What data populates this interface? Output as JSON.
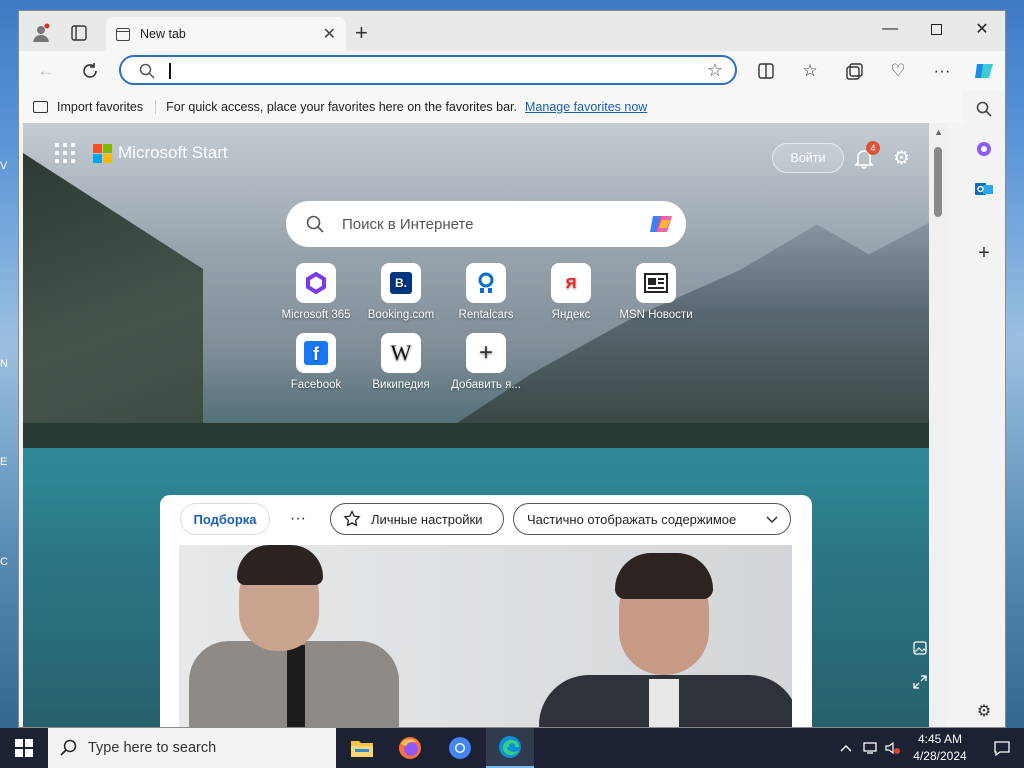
{
  "browser": {
    "tab_title": "New tab",
    "address_value": "",
    "favorites_bar": {
      "import_label": "Import favorites",
      "tip": "For quick access, place your favorites here on the favorites bar.",
      "manage_link": "Manage favorites now"
    }
  },
  "start_page": {
    "brand": "Microsoft Start",
    "sign_in": "Войти",
    "notifications_count": "4",
    "search_placeholder": "Поиск в Интернете",
    "tiles": [
      {
        "label": "Microsoft 365",
        "icon": "microsoft-365-icon"
      },
      {
        "label": "Booking.com",
        "icon": "booking-icon",
        "glyph": "B."
      },
      {
        "label": "Rentalcars",
        "icon": "rentalcars-icon"
      },
      {
        "label": "Яндекс",
        "icon": "yandex-icon",
        "glyph": "Я"
      },
      {
        "label": "MSN Новости",
        "icon": "msn-news-icon"
      },
      {
        "label": "Facebook",
        "icon": "facebook-icon",
        "glyph": "f"
      },
      {
        "label": "Википедия",
        "icon": "wikipedia-icon",
        "glyph": "W"
      },
      {
        "label": "Добавить я...",
        "icon": "add-icon",
        "glyph": "+"
      }
    ],
    "feed": {
      "pick_tab": "Подборка",
      "more": "···",
      "personalize": "Личные настройки",
      "content_mode": "Частично отображать содержимое"
    }
  },
  "taskbar": {
    "search_placeholder": "Type here to search",
    "time": "4:45 AM",
    "date": "4/28/2024"
  },
  "colors": {
    "accent": "#2c6fc9",
    "link": "#1a5fb4",
    "badge": "#e0533b",
    "taskbar": "#1c2233"
  }
}
